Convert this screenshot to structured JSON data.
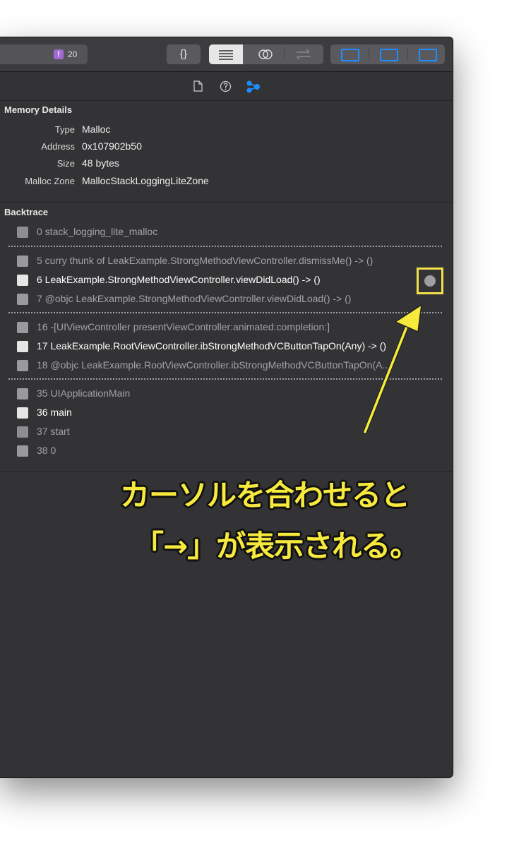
{
  "toolbar": {
    "issue_badge": "!",
    "issue_count": "20",
    "braces_label": "{}"
  },
  "memory_details": {
    "title": "Memory Details",
    "rows": [
      {
        "label": "Type",
        "value": "Malloc"
      },
      {
        "label": "Address",
        "value": "0x107902b50"
      },
      {
        "label": "Size",
        "value": "48 bytes"
      },
      {
        "label": "Malloc Zone",
        "value": "MallocStackLoggingLiteZone"
      }
    ]
  },
  "backtrace": {
    "title": "Backtrace",
    "frames": [
      {
        "text": "0 stack_logging_lite_malloc",
        "icon": "gear-icon",
        "style": "dim"
      },
      {
        "text": "5 curry thunk of LeakExample.StrongMethodViewController.dismissMe() -> ()",
        "icon": "user-icon",
        "style": "dim"
      },
      {
        "text": "6 LeakExample.StrongMethodViewController.viewDidLoad() -> ()",
        "icon": "user-icon",
        "style": "bright"
      },
      {
        "text": "7 @objc LeakExample.StrongMethodViewController.viewDidLoad() -> ()",
        "icon": "user-icon",
        "style": "dim"
      },
      {
        "text": "16 -[UIViewController presentViewController:animated:completion:]",
        "icon": "framework-icon",
        "style": "dim"
      },
      {
        "text": "17 LeakExample.RootViewController.ibStrongMethodVCButtonTapOn(Any) -> ()",
        "icon": "user-icon",
        "style": "bright"
      },
      {
        "text": "18 @objc LeakExample.RootViewController.ibStrongMethodVCButtonTapOn(A...",
        "icon": "user-icon",
        "style": "dim"
      },
      {
        "text": "35 UIApplicationMain",
        "icon": "framework-icon",
        "style": "dim"
      },
      {
        "text": "36 main",
        "icon": "user-icon",
        "style": "bright"
      },
      {
        "text": "37 start",
        "icon": "gear-icon",
        "style": "dim"
      },
      {
        "text": "38 0",
        "icon": "library-icon",
        "style": "dim"
      }
    ]
  },
  "annotation": {
    "line1": "カーソルを合わせると",
    "line2": "「→」が表示される。",
    "color": "#f7ea3d"
  },
  "colors": {
    "accent": "#1e8dff",
    "panel_bg": "#333335",
    "highlight": "#f4e14a"
  }
}
